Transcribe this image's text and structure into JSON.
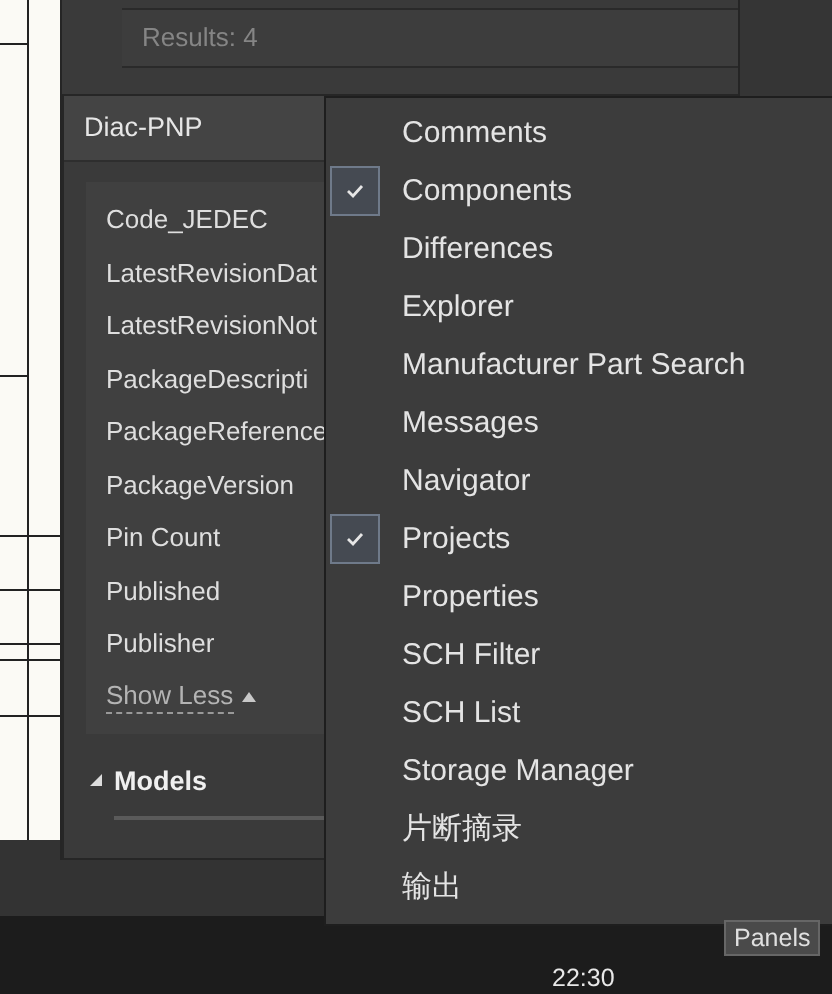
{
  "search": {
    "results": "Results: 4"
  },
  "panel": {
    "title": "Diac-PNP",
    "properties": [
      "Code_JEDEC",
      "LatestRevisionDat",
      "LatestRevisionNot",
      "PackageDescripti",
      "PackageReference",
      "PackageVersion",
      "Pin Count",
      "Published",
      "Publisher"
    ],
    "toggle": "Show Less",
    "section": {
      "title": "Models",
      "expanded": true
    }
  },
  "menu": {
    "items": [
      {
        "label": "Comments",
        "checked": false
      },
      {
        "label": "Components",
        "checked": true
      },
      {
        "label": "Differences",
        "checked": false
      },
      {
        "label": "Explorer",
        "checked": false
      },
      {
        "label": "Manufacturer Part Search",
        "checked": false
      },
      {
        "label": "Messages",
        "checked": false
      },
      {
        "label": "Navigator",
        "checked": false
      },
      {
        "label": "Projects",
        "checked": true
      },
      {
        "label": "Properties",
        "checked": false
      },
      {
        "label": "SCH Filter",
        "checked": false
      },
      {
        "label": "SCH List",
        "checked": false
      },
      {
        "label": "Storage Manager",
        "checked": false
      },
      {
        "label": "片断摘录",
        "checked": false
      },
      {
        "label": "输出",
        "checked": false
      }
    ]
  },
  "panels_button": "Panels",
  "taskbar": {
    "clock": "22:30"
  }
}
